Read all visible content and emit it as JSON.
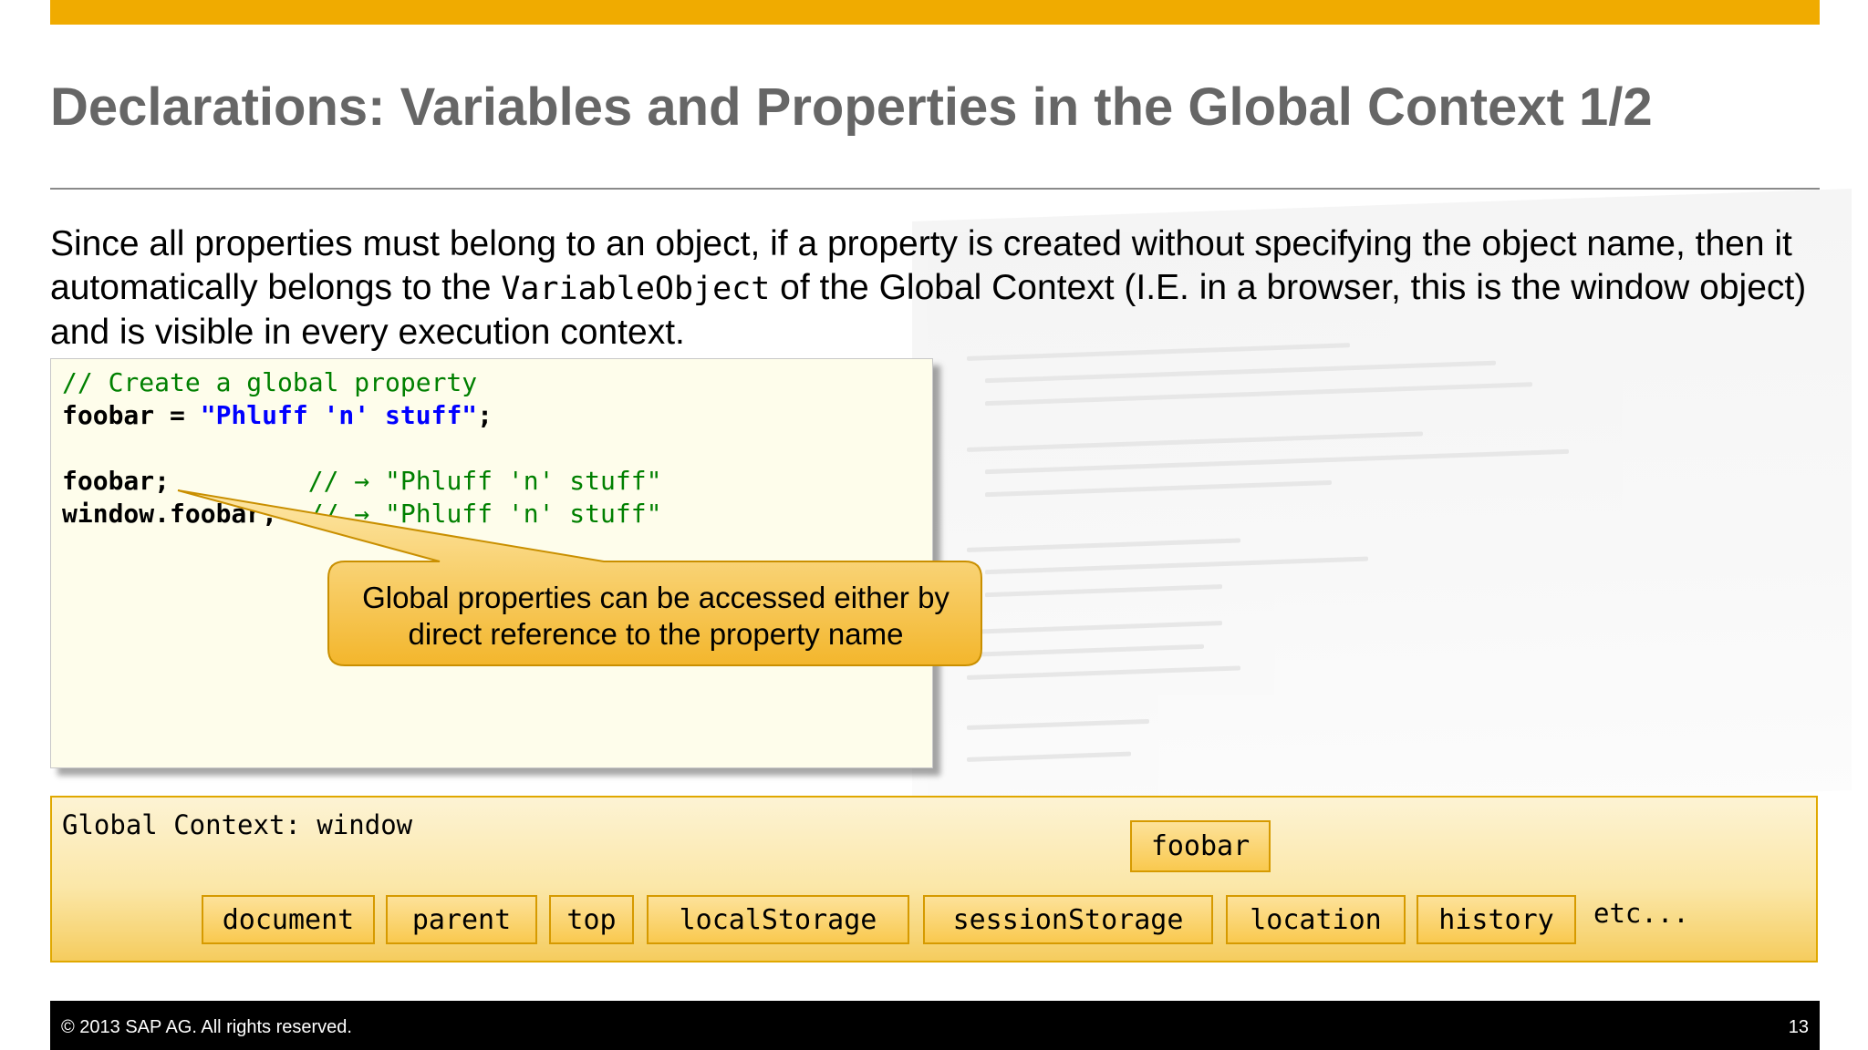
{
  "slide": {
    "title": "Declarations: Variables and Properties in the Global Context 1/2",
    "accent_color": "#f0ab00",
    "body": {
      "part1": "Since all properties must belong to an object, if a property is created without specifying the object name, then it automatically belongs to the ",
      "code": "VariableObject",
      "part2": " of the Global Context (I.E. in a browser, this is the window object) and is visible in every execution context."
    }
  },
  "code": {
    "line1_comment": "// Create a global property",
    "line2_ident": "foobar = ",
    "line2_string": "\"Phluff 'n' stuff\"",
    "line2_end": ";",
    "line4_ident": "foobar;",
    "line4_comment": "         // → \"Phluff 'n' stuff\"",
    "line5_ident": "window.foobar;",
    "line5_comment": "  // → \"Phluff 'n' stuff\""
  },
  "callout": {
    "text": "Global properties can be accessed either by direct reference to the property name"
  },
  "global_context": {
    "label": "Global Context: window",
    "new_property": "foobar",
    "properties": [
      "document",
      "parent",
      "top",
      "localStorage",
      "sessionStorage",
      "location",
      "history"
    ],
    "etc": "etc..."
  },
  "footer": {
    "copyright": "© 2013 SAP AG. All rights reserved.",
    "page_number": "13"
  }
}
